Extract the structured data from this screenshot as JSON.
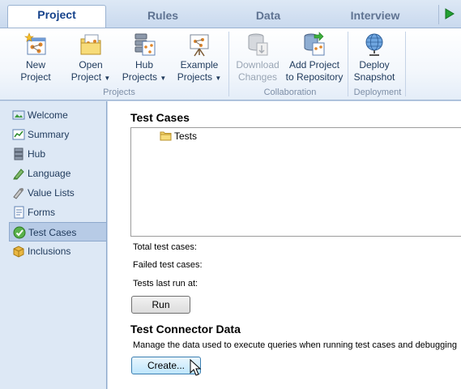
{
  "tabs": [
    {
      "label": "Project",
      "active": true
    },
    {
      "label": "Rules",
      "active": false
    },
    {
      "label": "Data",
      "active": false
    },
    {
      "label": "Interview",
      "active": false
    }
  ],
  "ribbon": {
    "groups": [
      "Projects",
      "Collaboration",
      "Deployment"
    ],
    "buttons": {
      "new_project": [
        "New",
        "Project"
      ],
      "open_project": [
        "Open",
        "Project"
      ],
      "hub_projects": [
        "Hub",
        "Projects"
      ],
      "example_projects": [
        "Example",
        "Projects"
      ],
      "download_changes": [
        "Download",
        "Changes"
      ],
      "add_project": [
        "Add Project",
        "to Repository"
      ],
      "deploy_snapshot": [
        "Deploy",
        "Snapshot"
      ]
    }
  },
  "sidebar": {
    "items": [
      {
        "label": "Welcome",
        "icon": "welcome-icon"
      },
      {
        "label": "Summary",
        "icon": "summary-icon"
      },
      {
        "label": "Hub",
        "icon": "hub-icon"
      },
      {
        "label": "Language",
        "icon": "language-icon"
      },
      {
        "label": "Value Lists",
        "icon": "value-lists-icon"
      },
      {
        "label": "Forms",
        "icon": "forms-icon"
      },
      {
        "label": "Test Cases",
        "icon": "test-cases-icon",
        "selected": true
      },
      {
        "label": "Inclusions",
        "icon": "inclusions-icon"
      }
    ]
  },
  "main": {
    "test_cases_title": "Test Cases",
    "tree": {
      "root": "Tests"
    },
    "stats": {
      "total": "Total test cases:",
      "failed": "Failed test cases:",
      "last_run": "Tests last run at:"
    },
    "run_button": "Run",
    "connector_title": "Test Connector Data",
    "connector_desc": "Manage the data used to execute queries when running test cases and debugging",
    "create_button": "Create..."
  },
  "colors": {
    "accent": "#15428b",
    "ribbon_bg": "#f3f7fc",
    "sidebar_bg": "#dde8f5",
    "selected_bg": "#b7cbe6"
  }
}
